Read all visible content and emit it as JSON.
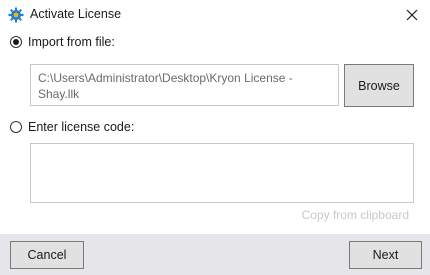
{
  "window": {
    "title": "Activate License",
    "icon": "gear-icon",
    "close_icon": "close-icon"
  },
  "import_option": {
    "label": "Import from file:",
    "selected": true
  },
  "file_path": {
    "value": "C:\\Users\\Administrator\\Desktop\\Kryon License - Shay.llk"
  },
  "browse_button": {
    "label": "Browse"
  },
  "code_option": {
    "label": "Enter license code:",
    "selected": false
  },
  "code_input": {
    "value": ""
  },
  "copy_link": {
    "label": "Copy from clipboard"
  },
  "footer": {
    "cancel_label": "Cancel",
    "next_label": "Next"
  },
  "colors": {
    "accent_icon": "#1e7fd6",
    "icon_highlight": "#f2b600",
    "footer_bg": "#e6e6ea",
    "disabled_text": "#c8c8c8"
  }
}
